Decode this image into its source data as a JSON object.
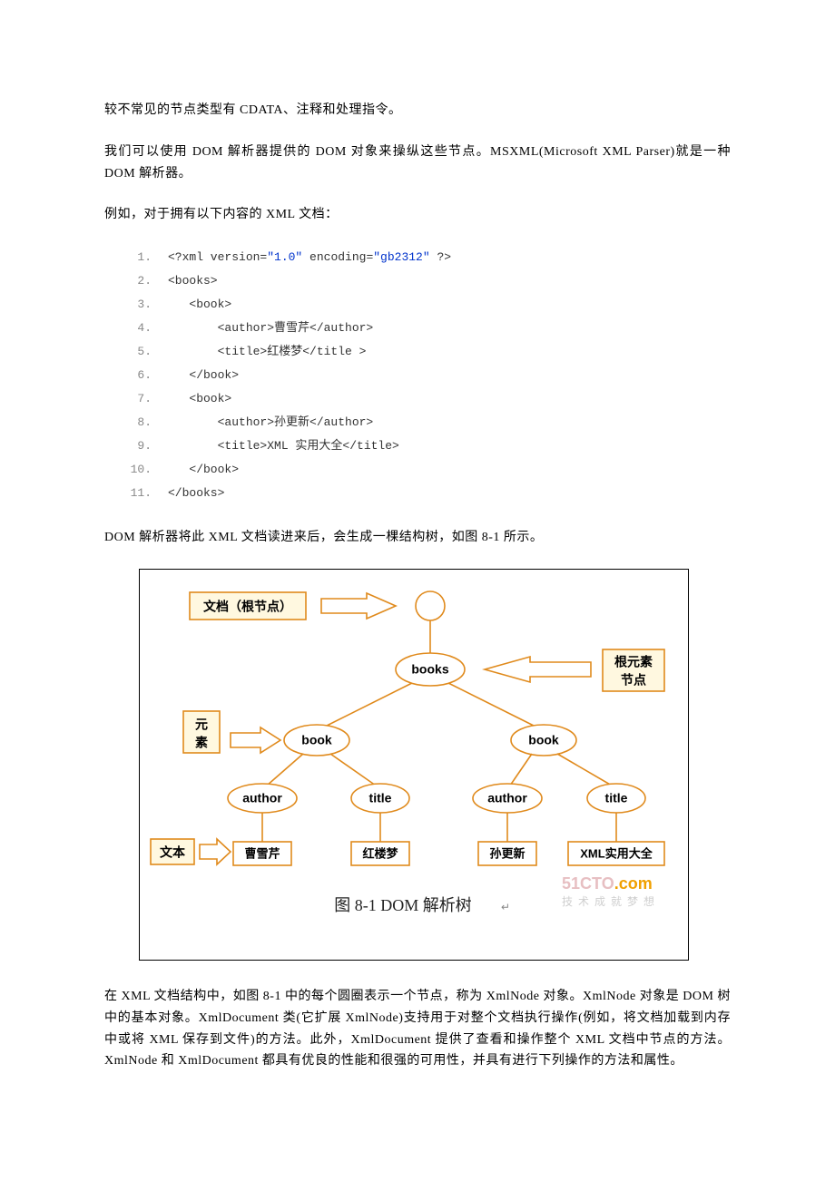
{
  "paragraphs": {
    "p1": "较不常见的节点类型有 CDATA、注释和处理指令。",
    "p2": "我们可以使用 DOM 解析器提供的 DOM 对象来操纵这些节点。MSXML(Microsoft XML Parser)就是一种 DOM 解析器。",
    "p3": "例如，对于拥有以下内容的 XML 文档：",
    "p4": "DOM 解析器将此 XML 文档读进来后，会生成一棵结构树，如图 8-1 所示。",
    "p5": "在 XML 文档结构中，如图 8-1 中的每个圆圈表示一个节点，称为 XmlNode 对象。XmlNode 对象是 DOM 树中的基本对象。XmlDocument 类(它扩展 XmlNode)支持用于对整个文档执行操作(例如，将文档加载到内存中或将 XML 保存到文件)的方法。此外，XmlDocument 提供了查看和操作整个 XML 文档中节点的方法。XmlNode 和 XmlDocument 都具有优良的性能和很强的可用性，并具有进行下列操作的方法和属性。"
  },
  "code": {
    "lines": [
      {
        "n": "1.",
        "pre": "<?xml version=",
        "s1": "\"1.0\"",
        "mid": " encoding=",
        "s2": "\"gb2312\"",
        "post": " ?>"
      },
      {
        "n": "2.",
        "pre": "<books>"
      },
      {
        "n": "3.",
        "pre": "   <book>"
      },
      {
        "n": "4.",
        "pre": "       <author>曹雪芹</author>"
      },
      {
        "n": "5.",
        "pre": "       <title>红楼梦</title >"
      },
      {
        "n": "6.",
        "pre": "   </book>"
      },
      {
        "n": "7.",
        "pre": "   <book>"
      },
      {
        "n": "8.",
        "pre": "       <author>孙更新</author>"
      },
      {
        "n": "9.",
        "pre": "       <title>XML 实用大全</title>"
      },
      {
        "n": "10.",
        "pre": "   </book>"
      },
      {
        "n": "11.",
        "pre": "</books>"
      }
    ]
  },
  "figure": {
    "labels": {
      "doc_root": "文档（根节点）",
      "root_element1": "根元素",
      "root_element2": "节点",
      "element1": "元",
      "element2": "素",
      "text": "文本"
    },
    "nodes": {
      "books": "books",
      "book": "book",
      "author": "author",
      "title": "title"
    },
    "leaves": {
      "a1": "曹雪芹",
      "t1": "红楼梦",
      "a2": "孙更新",
      "t2": "XML实用大全"
    },
    "caption": "图 8-1   DOM 解析树",
    "watermark": {
      "brand1": "51CTO",
      "brand2": ".com",
      "slogan": "技术成就梦想"
    }
  }
}
